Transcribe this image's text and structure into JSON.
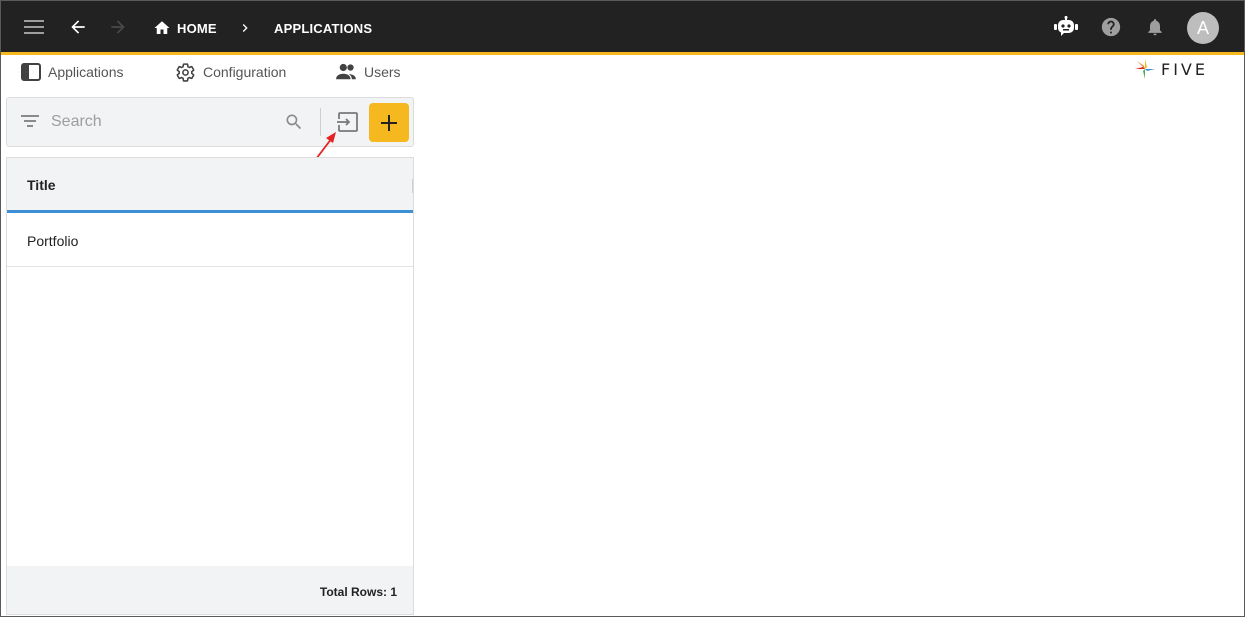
{
  "topbar": {
    "breadcrumb_home": "HOME",
    "breadcrumb_current": "APPLICATIONS",
    "avatar_initial": "A"
  },
  "nav": {
    "applications": "Applications",
    "configuration": "Configuration",
    "users": "Users"
  },
  "logo": {
    "text": "FIVE"
  },
  "search": {
    "placeholder": "Search",
    "value": ""
  },
  "list": {
    "column_title": "Title",
    "rows": [
      "Portfolio"
    ],
    "total_rows_label": "Total Rows: 1"
  },
  "colors": {
    "topbar_bg": "#222222",
    "accent": "#f5b81f",
    "header_underline": "#3d8fd6",
    "annotation": "#e32222"
  },
  "icons": [
    "menu-icon",
    "back-arrow-icon",
    "forward-arrow-icon",
    "home-icon",
    "chevron-right-icon",
    "chatbot-icon",
    "help-icon",
    "bell-icon",
    "applications-icon",
    "configuration-icon",
    "users-icon",
    "filter-icon",
    "search-icon",
    "import-icon",
    "plus-icon"
  ]
}
